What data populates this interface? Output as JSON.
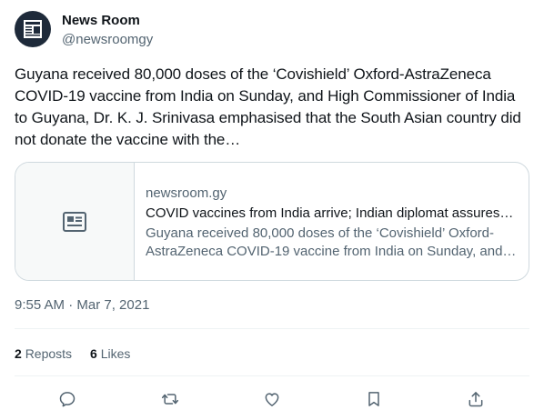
{
  "author": {
    "name": "News Room",
    "handle": "@newsroomgy",
    "avatar_icon": "news-logo-icon"
  },
  "post": {
    "text": "Guyana received 80,000 doses of the ‘Covishield’ Oxford-AstraZeneca COVID-19 vaccine from India on Sunday, and High Commissioner of India to Guyana, Dr. K. J. Srinivasa emphasised that the South Asian country did not donate the vaccine with the…",
    "timestamp": "9:55 AM · Mar 7, 2021"
  },
  "link_card": {
    "thumb_icon": "newspaper-icon",
    "domain": "newsroom.gy",
    "title": "COVID vaccines from India arrive; Indian diplomat assures…",
    "description": "Guyana received 80,000 doses of the ‘Covishield’ Oxford-AstraZeneca COVID-19 vaccine from India on Sunday, and…"
  },
  "stats": {
    "reposts_count": "2",
    "reposts_label": "Reposts",
    "likes_count": "6",
    "likes_label": "Likes"
  },
  "actions": [
    "reply-icon",
    "repost-icon",
    "like-icon",
    "bookmark-icon",
    "share-icon"
  ],
  "colors": {
    "text_primary": "#0f1419",
    "text_secondary": "#536471",
    "border": "#cfd9de",
    "divider": "#eff3f4"
  }
}
